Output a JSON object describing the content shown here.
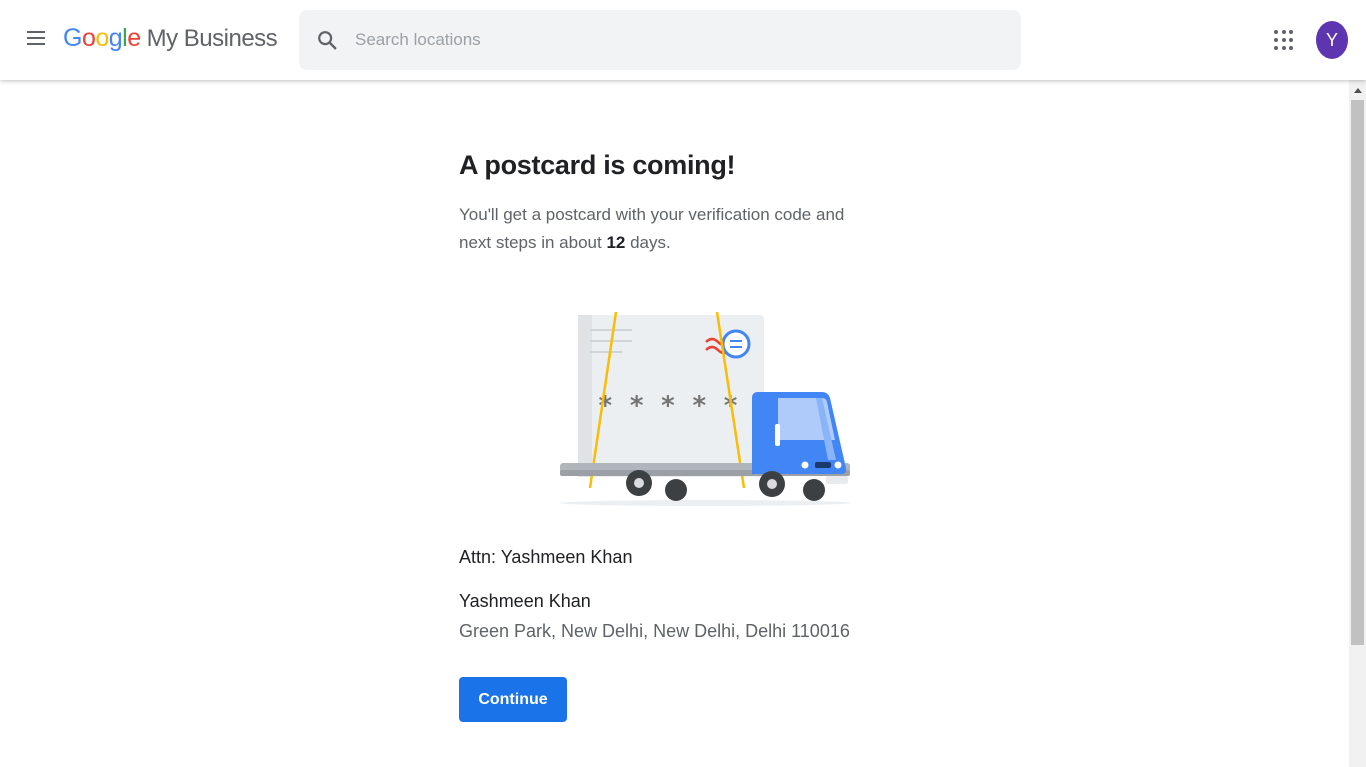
{
  "header": {
    "brand_letters": [
      {
        "char": "G",
        "color": "#4285F4"
      },
      {
        "char": "o",
        "color": "#EA4335"
      },
      {
        "char": "o",
        "color": "#FBBC05"
      },
      {
        "char": "g",
        "color": "#4285F4"
      },
      {
        "char": "l",
        "color": "#34A853"
      },
      {
        "char": "e",
        "color": "#EA4335"
      }
    ],
    "product_name": "My Business",
    "search_placeholder": "Search locations",
    "avatar_initial": "Y",
    "avatar_color": "#5E35B1",
    "icons": {
      "menu": "hamburger-menu-icon",
      "search": "search-icon",
      "apps": "apps-grid-icon"
    }
  },
  "main": {
    "title": "A postcard is coming!",
    "description_before": "You'll get a postcard with your verification code and next steps in about ",
    "days": "12",
    "description_after": " days.",
    "illustration": {
      "code_mask": "*****",
      "icon": "delivery-truck-illustration"
    },
    "attn": "Attn: Yashmeen Khan",
    "recipient_name": "Yashmeen Khan",
    "address": "Green Park, New Delhi, New Delhi, Delhi 110016",
    "continue_label": "Continue"
  },
  "colors": {
    "accent": "#1A73E8",
    "truck_blue": "#4285F4",
    "strap_yellow": "#FBBC04"
  }
}
